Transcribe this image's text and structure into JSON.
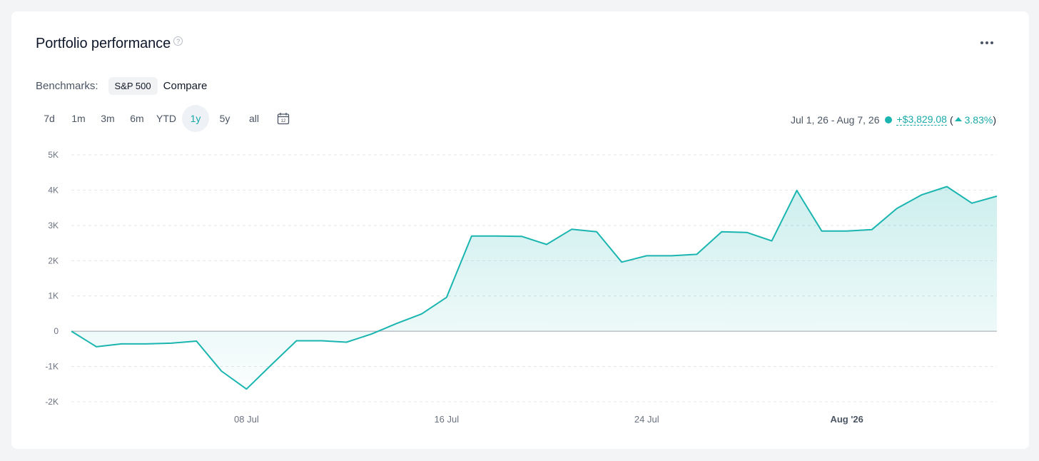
{
  "header": {
    "title": "Portfolio performance",
    "help_icon": "question-circle-icon",
    "more_icon": "more-horizontal-icon"
  },
  "benchmarks": {
    "label": "Benchmarks:",
    "chip": "S&P 500",
    "compare": "Compare"
  },
  "ranges": [
    "7d",
    "1m",
    "3m",
    "6m",
    "YTD",
    "1y",
    "5y",
    "all"
  ],
  "active_range": "1y",
  "calendar_icon": "calendar-icon",
  "summary": {
    "date_range": "Jul 1, 26 - Aug 7, 26",
    "gain": "+$3,829.08",
    "paren_open": "(",
    "pct": "3.83%",
    "paren_close": ")"
  },
  "colors": {
    "accent": "#1bb5b0",
    "text_accent": "#1aa9a9"
  },
  "chart_data": {
    "type": "area",
    "ylim": [
      -2000,
      5000
    ],
    "yticks": [
      {
        "value": 5000,
        "label": "5K"
      },
      {
        "value": 4000,
        "label": "4K"
      },
      {
        "value": 3000,
        "label": "3K"
      },
      {
        "value": 2000,
        "label": "2K"
      },
      {
        "value": 1000,
        "label": "1K"
      },
      {
        "value": 0,
        "label": "0"
      },
      {
        "value": -1000,
        "label": "-1K"
      },
      {
        "value": -2000,
        "label": "-2K"
      }
    ],
    "xticks": [
      {
        "date": "2026-07-08",
        "label": "08 Jul",
        "bold": false
      },
      {
        "date": "2026-07-16",
        "label": "16 Jul",
        "bold": false
      },
      {
        "date": "2026-07-24",
        "label": "24 Jul",
        "bold": false
      },
      {
        "date": "2026-08-01",
        "label": "Aug '26",
        "bold": true
      }
    ],
    "grid": true,
    "x": [
      "2026-07-01",
      "2026-07-02",
      "2026-07-03",
      "2026-07-04",
      "2026-07-05",
      "2026-07-06",
      "2026-07-07",
      "2026-07-08",
      "2026-07-09",
      "2026-07-10",
      "2026-07-11",
      "2026-07-12",
      "2026-07-13",
      "2026-07-14",
      "2026-07-15",
      "2026-07-16",
      "2026-07-17",
      "2026-07-18",
      "2026-07-19",
      "2026-07-20",
      "2026-07-21",
      "2026-07-22",
      "2026-07-23",
      "2026-07-24",
      "2026-07-25",
      "2026-07-26",
      "2026-07-27",
      "2026-07-28",
      "2026-07-29",
      "2026-07-30",
      "2026-07-31",
      "2026-08-01",
      "2026-08-02",
      "2026-08-03",
      "2026-08-04",
      "2026-08-05",
      "2026-08-06",
      "2026-08-07"
    ],
    "values": [
      0,
      -440,
      -360,
      -360,
      -340,
      -280,
      -1130,
      -1640,
      -950,
      -270,
      -270,
      -310,
      -80,
      220,
      490,
      960,
      2700,
      2700,
      2690,
      2460,
      2890,
      2820,
      1960,
      2140,
      2140,
      2180,
      2820,
      2800,
      2560,
      3990,
      2840,
      2840,
      2880,
      3480,
      3870,
      4100,
      3630,
      3829
    ]
  }
}
